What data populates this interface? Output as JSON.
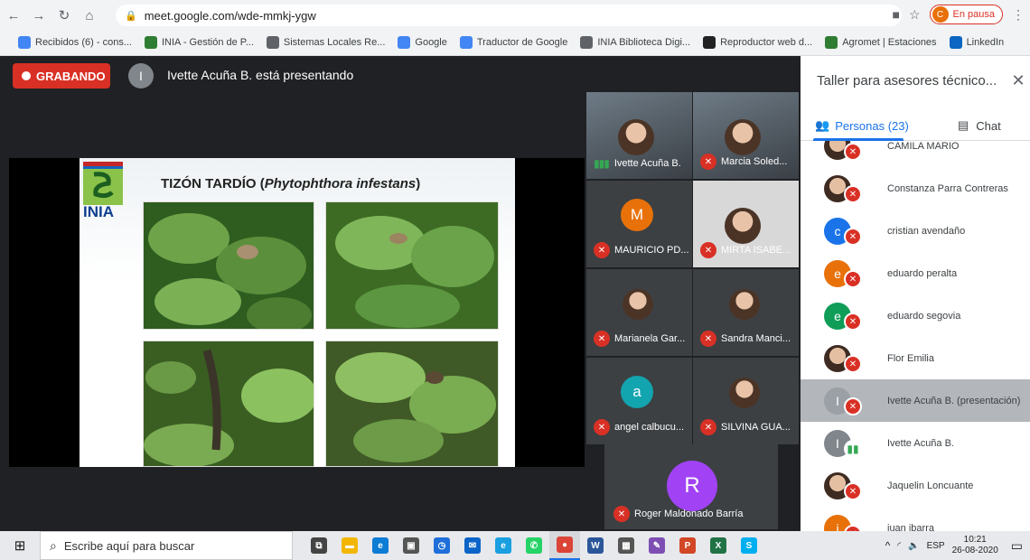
{
  "browser": {
    "url": "meet.google.com/wde-mmkj-ygw",
    "profile_initial": "C",
    "profile_status": "En pausa",
    "bookmarks": [
      {
        "label": "Recibidos (6) - cons...",
        "icon": "google-icon",
        "color": "#4285f4"
      },
      {
        "label": "INIA - Gestión de P...",
        "icon": "inia-icon",
        "color": "#2e7d32"
      },
      {
        "label": "Sistemas Locales Re...",
        "icon": "globe-icon",
        "color": "#5f6368"
      },
      {
        "label": "Google",
        "icon": "google-icon",
        "color": "#4285f4"
      },
      {
        "label": "Traductor de Google",
        "icon": "translate-icon",
        "color": "#4285f4"
      },
      {
        "label": "INIA Biblioteca Digi...",
        "icon": "globe-icon",
        "color": "#5f6368"
      },
      {
        "label": "Reproductor web d...",
        "icon": "spotify-icon",
        "color": "#222"
      },
      {
        "label": "Agromet | Estaciones",
        "icon": "agromet-icon",
        "color": "#2e7d32"
      },
      {
        "label": "LinkedIn",
        "icon": "linkedin-icon",
        "color": "#0a66c2"
      }
    ]
  },
  "meeting": {
    "recording_label": "GRABANDO",
    "presenter_initial": "I",
    "presenter_text": "Ivette Acuña B. está presentando"
  },
  "slide": {
    "logo_text": "INIA",
    "title_prefix": "TIZÓN TARDÍO (",
    "title_italic": "Phytophthora infestans",
    "title_suffix": ")"
  },
  "tiles": [
    {
      "name": "Ivette Acuña B.",
      "type": "video",
      "status": "talking"
    },
    {
      "name": "Marcia Soled...",
      "type": "video",
      "status": "muted"
    },
    {
      "name": "MAURICIO PD...",
      "type": "initial",
      "initial": "M",
      "color": "#e8710a",
      "status": "muted"
    },
    {
      "name": "MIRTA ISABE...",
      "type": "video",
      "status": "muted"
    },
    {
      "name": "Marianela Gar...",
      "type": "photo",
      "status": "muted"
    },
    {
      "name": "Sandra Manci...",
      "type": "photo",
      "status": "muted"
    },
    {
      "name": "angel calbucu...",
      "type": "initial",
      "initial": "a",
      "color": "#12a4af",
      "status": "muted"
    },
    {
      "name": "SILVINA GUA...",
      "type": "photo",
      "status": "muted"
    }
  ],
  "big_tile": {
    "name": "Roger Maldonado Barría",
    "initial": "R",
    "color": "#a142f4"
  },
  "panel": {
    "title": "Taller para asesores técnico...",
    "people_tab": "Personas (23)",
    "chat_tab": "Chat",
    "people": [
      {
        "name": "CAMILA MARIO",
        "avatar": "photo",
        "badge": "muted"
      },
      {
        "name": "Constanza Parra Contreras",
        "avatar": "photo",
        "badge": "muted"
      },
      {
        "name": "cristian avendaño",
        "avatar": "c",
        "color": "#1a73e8",
        "badge": "muted"
      },
      {
        "name": "eduardo peralta",
        "avatar": "e",
        "color": "#e8710a",
        "badge": "muted"
      },
      {
        "name": "eduardo segovia",
        "avatar": "e",
        "color": "#0f9d58",
        "badge": "muted"
      },
      {
        "name": "Flor Emilia",
        "avatar": "photo",
        "badge": "muted"
      },
      {
        "name": "Ivette Acuña B. (presentación)",
        "avatar": "I",
        "color": "#9aa0a6",
        "badge": "muted",
        "highlight": true
      },
      {
        "name": "Ivette Acuña B.",
        "avatar": "I",
        "color": "#80868b",
        "badge": "talking"
      },
      {
        "name": "Jaquelin Loncuante",
        "avatar": "photo",
        "badge": "muted"
      },
      {
        "name": "juan ibarra",
        "avatar": "j",
        "color": "#e8710a",
        "badge": "muted"
      }
    ]
  },
  "taskbar": {
    "search_placeholder": "Escribe aquí para buscar",
    "language": "ESP",
    "time": "10:21",
    "date": "26-08-2020",
    "apps": [
      {
        "icon": "task-view-icon",
        "color": "#444",
        "glyph": "⧉"
      },
      {
        "icon": "file-explorer-icon",
        "color": "#f2b600",
        "glyph": "▬"
      },
      {
        "icon": "edge-icon",
        "color": "#0c7cd5",
        "glyph": "e"
      },
      {
        "icon": "store-icon",
        "color": "#555",
        "glyph": "▣"
      },
      {
        "icon": "calendar-icon",
        "color": "#1e6fd9",
        "glyph": "◷"
      },
      {
        "icon": "mail-icon",
        "color": "#0a64c8",
        "glyph": "✉"
      },
      {
        "icon": "internet-explorer-icon",
        "color": "#1a9fe0",
        "glyph": "e"
      },
      {
        "icon": "whatsapp-icon",
        "color": "#25d366",
        "glyph": "✆"
      },
      {
        "icon": "chrome-icon",
        "color": "#db4437",
        "glyph": "●",
        "active": true
      },
      {
        "icon": "word-icon",
        "color": "#2b579a",
        "glyph": "W"
      },
      {
        "icon": "calculator-icon",
        "color": "#555",
        "glyph": "▦"
      },
      {
        "icon": "paint-icon",
        "color": "#7d4fb3",
        "glyph": "✎"
      },
      {
        "icon": "powerpoint-icon",
        "color": "#d24726",
        "glyph": "P"
      },
      {
        "icon": "excel-icon",
        "color": "#217346",
        "glyph": "X"
      },
      {
        "icon": "skype-icon",
        "color": "#00aff0",
        "glyph": "S"
      }
    ]
  }
}
